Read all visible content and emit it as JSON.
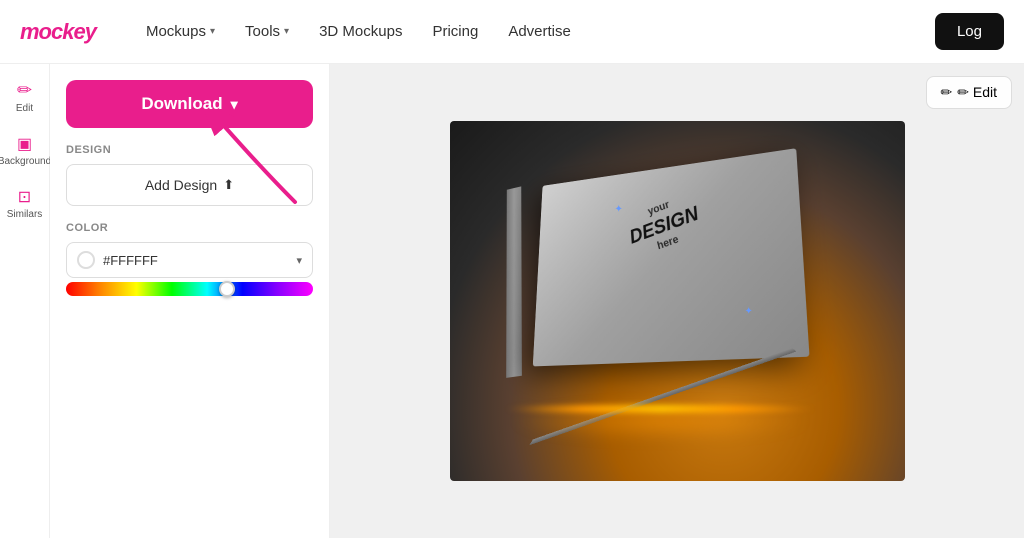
{
  "header": {
    "logo": "mockey",
    "nav": [
      {
        "label": "Mockups",
        "hasDropdown": true
      },
      {
        "label": "Tools",
        "hasDropdown": true
      },
      {
        "label": "3D Mockups",
        "hasDropdown": false
      },
      {
        "label": "Pricing",
        "hasDropdown": false
      },
      {
        "label": "Advertise",
        "hasDropdown": false
      }
    ],
    "login_label": "Log"
  },
  "sidebar_icons": [
    {
      "icon": "✏️",
      "label": "Edit"
    },
    {
      "icon": "⊞",
      "label": "Background"
    },
    {
      "icon": "◫",
      "label": "Similars"
    }
  ],
  "panel": {
    "download_label": "Download",
    "design_section_label": "DESIGN",
    "add_design_label": "Add Design",
    "color_section_label": "COLOR",
    "color_value": "#FFFFFF",
    "color_display": "#FFFFFF"
  },
  "canvas": {
    "edit_label": "✏ Edit"
  }
}
